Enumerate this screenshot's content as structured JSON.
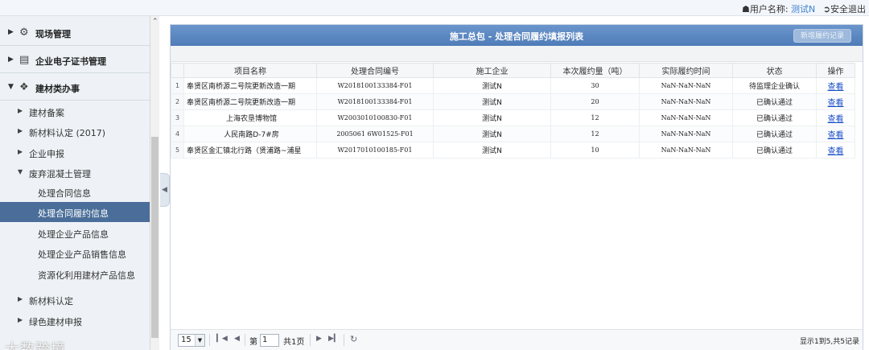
{
  "topbar": {
    "user_label": "用户名称:",
    "user_name": "测试N",
    "logout": "安全退出"
  },
  "sidebar": {
    "top_items": [
      {
        "label": "现场管理",
        "icon": "gears-icon"
      },
      {
        "label": "企业电子证书管理",
        "icon": "certificate-icon"
      },
      {
        "label": "建材类办事",
        "icon": "cubes-icon",
        "expanded": true
      }
    ],
    "sub_items": [
      {
        "label": "建材备案"
      },
      {
        "label": "新材料认定 (2017)"
      },
      {
        "label": "企业申报"
      },
      {
        "label": "废弃混凝土管理",
        "expanded": true
      }
    ],
    "leaf_items": [
      {
        "label": "处理合同信息"
      },
      {
        "label": "处理合同履约信息",
        "active": true
      },
      {
        "label": "处理企业产品信息"
      },
      {
        "label": "处理企业产品销售信息"
      },
      {
        "label": "资源化利用建材产品信息"
      }
    ],
    "after_items": [
      {
        "label": "新材料认定"
      },
      {
        "label": "绿色建材申报"
      }
    ],
    "watermark": "大数跨境"
  },
  "panel": {
    "title": "施工总包 - 处理合同履约填报列表",
    "add_button": "新增履约记录"
  },
  "table": {
    "headers": [
      "项目名称",
      "处理合同编号",
      "施工企业",
      "本次履约量（吨）",
      "实际履约时间",
      "状态",
      "操作"
    ],
    "rows": [
      {
        "no": "1",
        "name": "奉贤区南桥源二号院更新改造一期",
        "contract": "W2018100133384-F01",
        "company": "测试N",
        "amount": "30",
        "time": "NaN-NaN-NaN",
        "status": "待监理企业确认",
        "action": "查看"
      },
      {
        "no": "2",
        "name": "奉贤区南桥源二号院更新改造一期",
        "contract": "W2018100133384-F01",
        "company": "测试N",
        "amount": "20",
        "time": "NaN-NaN-NaN",
        "status": "已确认通过",
        "action": "查看"
      },
      {
        "no": "3",
        "name": "上海农垦博物馆",
        "contract": "W2003010100830-F01",
        "company": "测试N",
        "amount": "12",
        "time": "NaN-NaN-NaN",
        "status": "已确认通过",
        "action": "查看"
      },
      {
        "no": "4",
        "name": "人民南路D-7#房",
        "contract": "2005061 6W01525-F01",
        "company": "测试N",
        "amount": "12",
        "time": "NaN-NaN-NaN",
        "status": "已确认通过",
        "action": "查看"
      },
      {
        "no": "5",
        "name": "奉贤区金汇镇北行路（贤浦路~浦星",
        "contract": "W2017010100185-F01",
        "company": "测试N",
        "amount": "10",
        "time": "NaN-NaN-NaN",
        "status": "已确认通过",
        "action": "查看"
      }
    ]
  },
  "pager": {
    "page_size": "15",
    "page_prefix": "第",
    "page_value": "1",
    "page_suffix": "共1页",
    "info": "显示1到5,共5记录"
  }
}
